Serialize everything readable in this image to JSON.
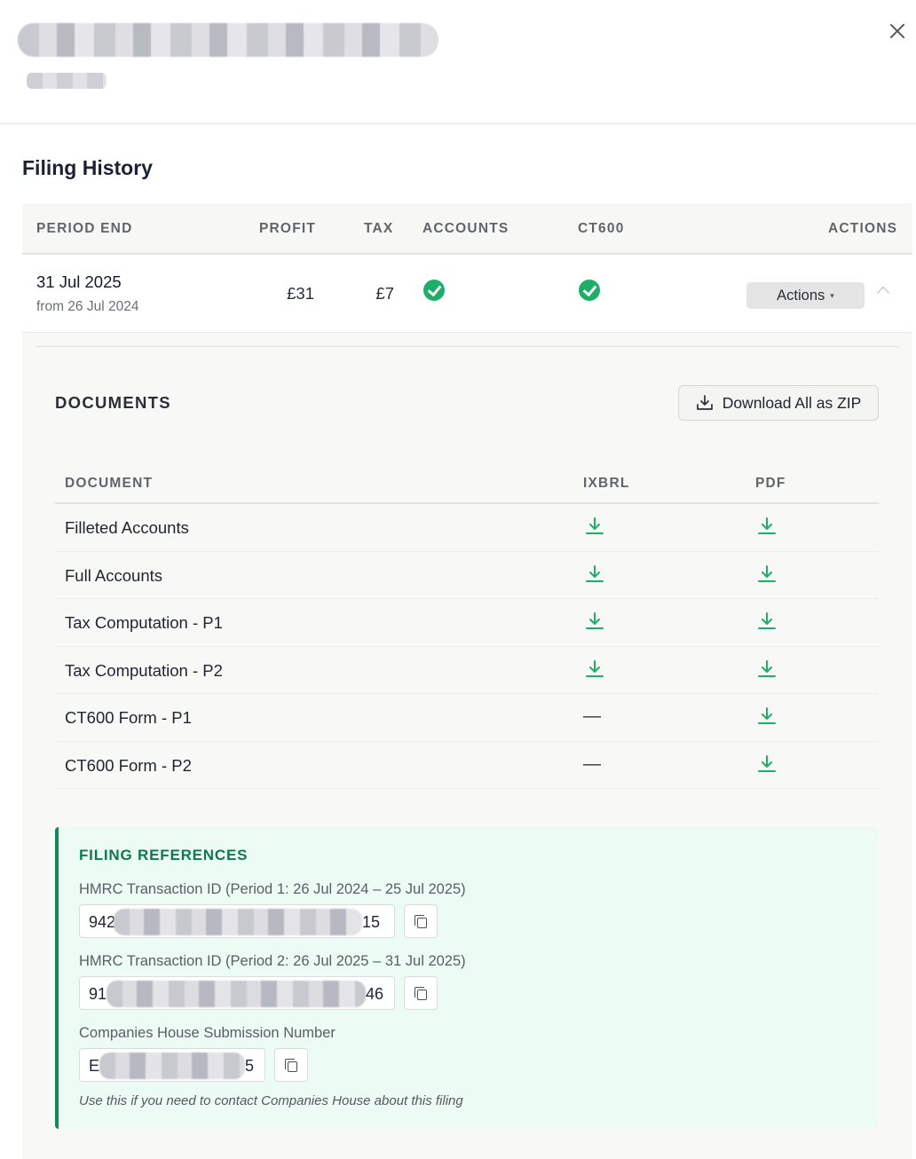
{
  "header": {
    "title": "",
    "subtitle": "",
    "close_label": "×"
  },
  "section_title": "Filing History",
  "filing_table": {
    "columns": [
      "PERIOD END",
      "PROFIT",
      "TAX",
      "ACCOUNTS",
      "CT600",
      "ACTIONS"
    ],
    "rows": [
      {
        "period_end": "31 Jul 2025",
        "period_from": "from 26 Jul 2024",
        "profit": "£31",
        "tax": "£7",
        "accounts_status": "filed",
        "ct600_status": "filed",
        "actions_label": "Actions",
        "actions_caret": "▾"
      }
    ]
  },
  "documents": {
    "title": "DOCUMENTS",
    "download_zip_label": "Download All as ZIP",
    "columns": [
      "DOCUMENT",
      "IXBRL",
      "PDF"
    ],
    "rows": [
      {
        "name": "Filleted Accounts",
        "ixbrl": "download",
        "pdf": "download"
      },
      {
        "name": "Full Accounts",
        "ixbrl": "download",
        "pdf": "download"
      },
      {
        "name": "Tax Computation - P1",
        "ixbrl": "download",
        "pdf": "download"
      },
      {
        "name": "Tax Computation - P2",
        "ixbrl": "download",
        "pdf": "download"
      },
      {
        "name": "CT600 Form - P1",
        "ixbrl": "—",
        "pdf": "download"
      },
      {
        "name": "CT600 Form - P2",
        "ixbrl": "—",
        "pdf": "download"
      }
    ]
  },
  "filing_references": {
    "title": "FILING REFERENCES",
    "items": [
      {
        "label": "HMRC Transaction ID (Period 1: 26 Jul 2024 – 25 Jul 2025)",
        "value_start": "942",
        "value_end": "15"
      },
      {
        "label": "HMRC Transaction ID (Period 2: 26 Jul 2025 – 31 Jul 2025)",
        "value_start": "91",
        "value_end": "46"
      },
      {
        "label": "Companies House Submission Number",
        "value_start": "E",
        "value_end": "5"
      }
    ],
    "note": "Use this if you need to contact Companies House about this filing"
  },
  "colors": {
    "accent_green": "#1fae6a",
    "reference_green": "#0c7a4c",
    "heading": "#1b2233"
  },
  "icons": {
    "close": "close-icon",
    "check": "check-circle-icon",
    "download": "download-icon",
    "copy": "copy-icon",
    "collapse": "chevron-up-icon"
  }
}
